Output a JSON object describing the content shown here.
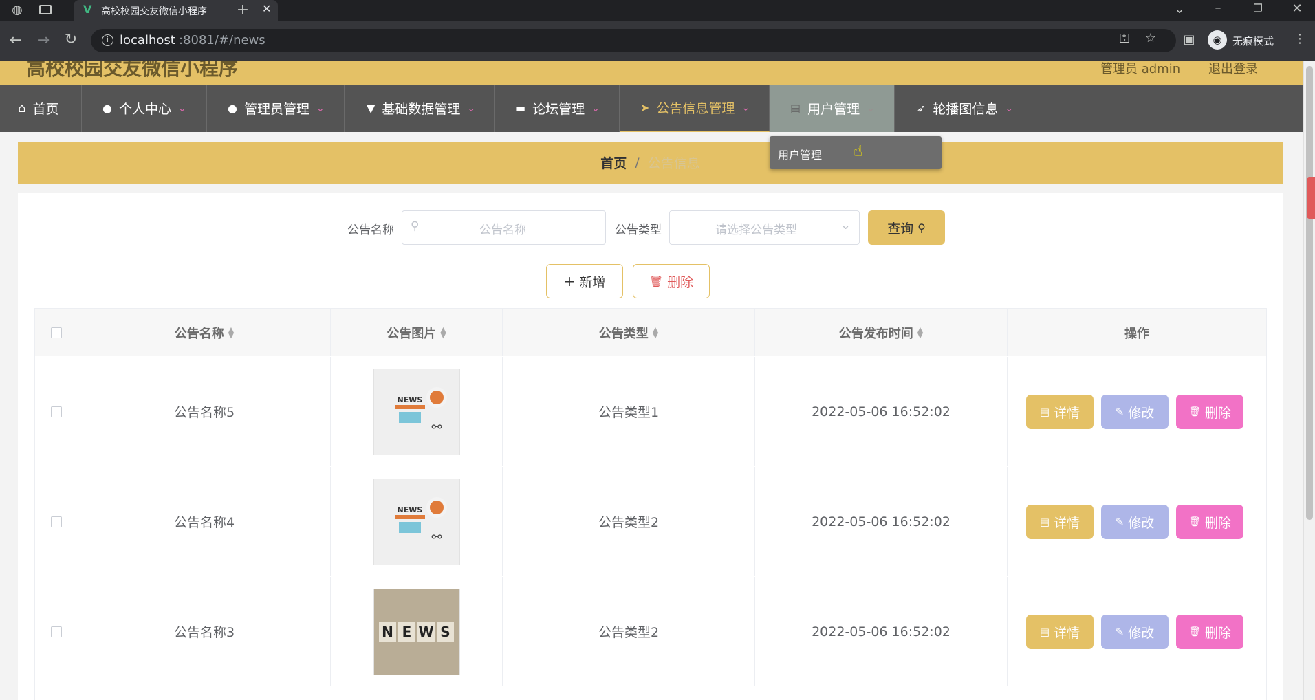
{
  "browser": {
    "tab_title": "高校校园交友微信小程序",
    "url_host": "localhost",
    "url_rest": ":8081/#/news",
    "incognito_label": "无痕模式"
  },
  "header": {
    "title": "高校校园交友微信小程序",
    "admin_text": "管理员 admin",
    "logout": "退出登录"
  },
  "nav": {
    "items": [
      {
        "label": "首页",
        "icon": "home-icon"
      },
      {
        "label": "个人中心",
        "icon": "user-icon"
      },
      {
        "label": "管理员管理",
        "icon": "user-icon"
      },
      {
        "label": "基础数据管理",
        "icon": "pin-icon"
      },
      {
        "label": "论坛管理",
        "icon": "briefcase-icon"
      },
      {
        "label": "公告信息管理",
        "icon": "send-icon"
      },
      {
        "label": "用户管理",
        "icon": "clipboard-icon"
      },
      {
        "label": "轮播图信息",
        "icon": "navigation-icon"
      }
    ],
    "dropdown_item": "用户管理"
  },
  "breadcrumb": {
    "home": "首页",
    "sep": "/",
    "current": "公告信息"
  },
  "search": {
    "name_label": "公告名称",
    "name_placeholder": "公告名称",
    "type_label": "公告类型",
    "type_placeholder": "请选择公告类型",
    "query_button": "查询"
  },
  "actions": {
    "add": "新增",
    "delete": "删除"
  },
  "table": {
    "headers": [
      "公告名称",
      "公告图片",
      "公告类型",
      "公告发布时间",
      "操作"
    ],
    "rows": [
      {
        "name": "公告名称5",
        "type": "公告类型1",
        "time": "2022-05-06 16:52:02",
        "image": "news-illustration"
      },
      {
        "name": "公告名称4",
        "type": "公告类型2",
        "time": "2022-05-06 16:52:02",
        "image": "news-illustration"
      },
      {
        "name": "公告名称3",
        "type": "公告类型2",
        "time": "2022-05-06 16:52:02",
        "image": "news-cubes-photo"
      }
    ],
    "op_labels": {
      "detail": "详情",
      "edit": "修改",
      "delete": "删除"
    }
  },
  "image_texts": {
    "news_small": "NEWS",
    "news_cubes": [
      "N",
      "E",
      "W",
      "S"
    ]
  },
  "colors": {
    "accent": "#e4c166",
    "nav_bg": "#545454",
    "edit": "#aeb6e8",
    "delete": "#f272c6"
  }
}
